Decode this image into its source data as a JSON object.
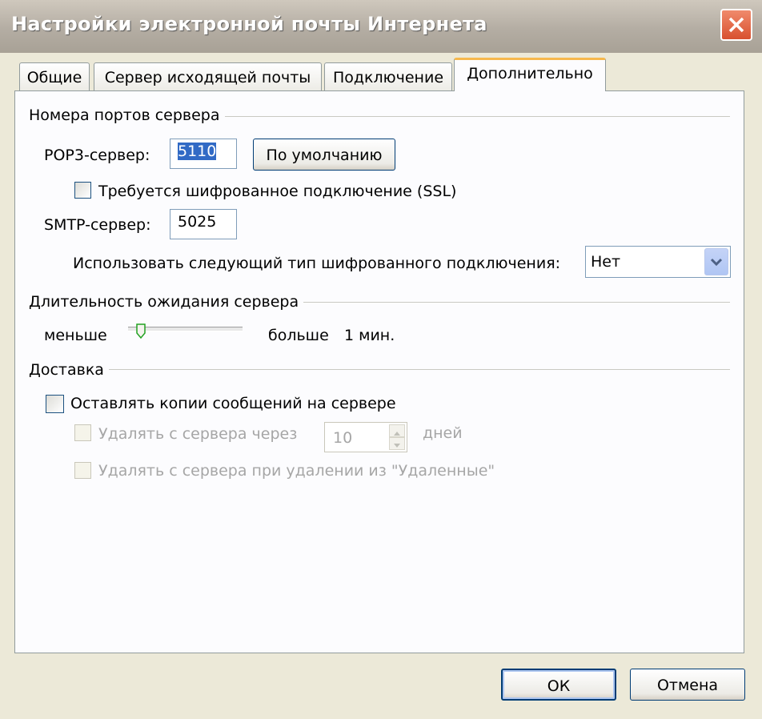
{
  "window": {
    "title": "Настройки электронной почты Интернета"
  },
  "tabs": [
    {
      "label": "Общие",
      "active": false
    },
    {
      "label": "Сервер исходящей почты",
      "active": false
    },
    {
      "label": "Подключение",
      "active": false
    },
    {
      "label": "Дополнительно",
      "active": true
    }
  ],
  "ports": {
    "group_label": "Номера портов сервера",
    "pop3_label": "POP3-сервер:",
    "pop3_value": "5110",
    "default_button": "По умолчанию",
    "ssl_checkbox_label": "Требуется шифрованное подключение (SSL)",
    "ssl_checked": false,
    "smtp_label": "SMTP-сервер:",
    "smtp_value": "5025",
    "encryption_label": "Использовать следующий тип шифрованного подключения:",
    "encryption_value": "Нет"
  },
  "timeout": {
    "group_label": "Длительность ожидания сервера",
    "less_label": "меньше",
    "more_label": "больше",
    "value_label": "1 мин."
  },
  "delivery": {
    "group_label": "Доставка",
    "keep_copies_label": "Оставлять копии сообщений на сервере",
    "keep_copies_checked": false,
    "remove_after_label": "Удалять с сервера через",
    "remove_after_days": "10",
    "days_label": "дней",
    "remove_deleted_label": "Удалять с сервера при удалении из \"Удаленные\""
  },
  "footer": {
    "ok_label": "ОК",
    "cancel_label": "Отмена"
  },
  "colors": {
    "titlebar": "#b4ada3",
    "dialog_bg": "#ece9d8",
    "close_button": "#d8512f",
    "active_tab_accent": "#f6b84c",
    "selection": "#316ac5"
  }
}
